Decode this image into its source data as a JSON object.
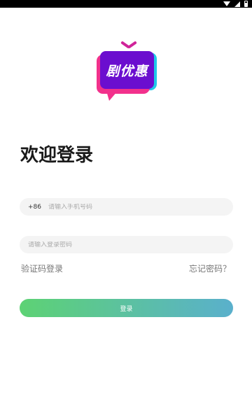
{
  "status_bar": {
    "icons": [
      "wifi-icon",
      "signal-icon",
      "battery-icon"
    ]
  },
  "logo": {
    "text": "剧优惠",
    "colors": {
      "screen": "#6b0ecf",
      "pink": "#f2318c",
      "cyan": "#1ec9e8"
    }
  },
  "title": "欢迎登录",
  "phone": {
    "prefix": "+86",
    "placeholder": "请输入手机号码",
    "value": ""
  },
  "password": {
    "placeholder": "请输入登录密码",
    "value": ""
  },
  "links": {
    "sms_login": "验证码登录",
    "forgot_password": "忘记密码？"
  },
  "login_button": {
    "label": "登录",
    "gradient": [
      "#5dd274",
      "#5ab0cc"
    ]
  }
}
